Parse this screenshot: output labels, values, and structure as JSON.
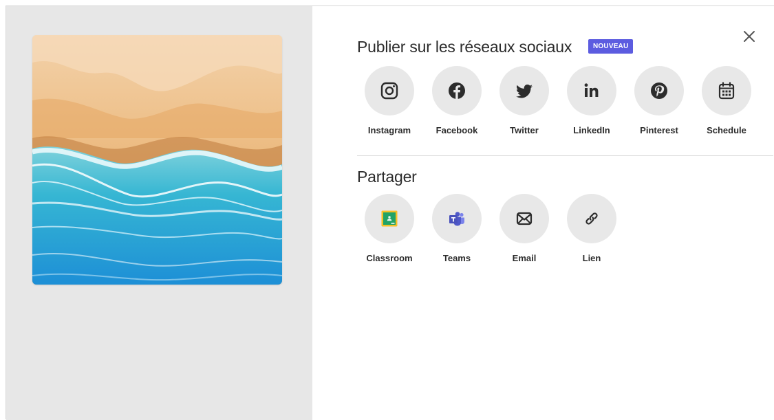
{
  "social": {
    "title": "Publier sur les réseaux sociaux",
    "badge": "NOUVEAU",
    "items": [
      {
        "label": "Instagram",
        "icon": "instagram-icon"
      },
      {
        "label": "Facebook",
        "icon": "facebook-icon"
      },
      {
        "label": "Twitter",
        "icon": "twitter-icon"
      },
      {
        "label": "LinkedIn",
        "icon": "linkedin-icon"
      },
      {
        "label": "Pinterest",
        "icon": "pinterest-icon"
      },
      {
        "label": "Schedule",
        "icon": "calendar-icon"
      }
    ]
  },
  "share": {
    "title": "Partager",
    "items": [
      {
        "label": "Classroom",
        "icon": "google-classroom-icon"
      },
      {
        "label": "Teams",
        "icon": "microsoft-teams-icon"
      },
      {
        "label": "Email",
        "icon": "email-icon"
      },
      {
        "label": "Lien",
        "icon": "link-icon"
      }
    ]
  },
  "preview": {
    "image": "aerial beach photo"
  },
  "colors": {
    "badge": "#5c5ce0",
    "preview_pane": "#e7e7e7",
    "icon_circle": "#e8e8e8",
    "icon": "#2c2c2c"
  }
}
